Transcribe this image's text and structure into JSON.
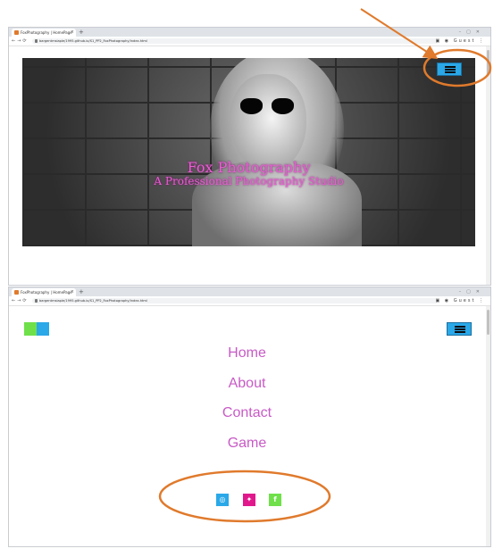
{
  "browser_top": {
    "tab_title": "FoxPhotography | HomePage",
    "tab_close": "×",
    "new_tab": "+",
    "url": "bargentmsiapie/1995.github.io/S1_PP2_FoxPhotography/index.html",
    "profile_label": "Guest"
  },
  "browser_bottom": {
    "tab_title": "FoxPhotography | HomePage",
    "tab_close": "×",
    "new_tab": "+",
    "url": "bargentmsiapie/1995.github.io/S1_PP2_FoxPhotography/index.html",
    "profile_label": "Guest"
  },
  "hero": {
    "title": "Fox Photography",
    "subtitle": "A Professional Photography Studio"
  },
  "menu": {
    "items": [
      "Home",
      "About",
      "Contact",
      "Game"
    ]
  },
  "social": [
    {
      "name": "instagram",
      "glyph": "◎",
      "color": "#2aa8e8"
    },
    {
      "name": "twitter",
      "glyph": "✦",
      "color": "#e0188c"
    },
    {
      "name": "facebook",
      "glyph": "f",
      "color": "#6fe04a"
    }
  ],
  "colors": {
    "accent_pink": "#e75fd1",
    "menu_text": "#c85ac6",
    "hamburger_blue": "#2aa8e8",
    "annotation_orange": "#e07a2c"
  }
}
